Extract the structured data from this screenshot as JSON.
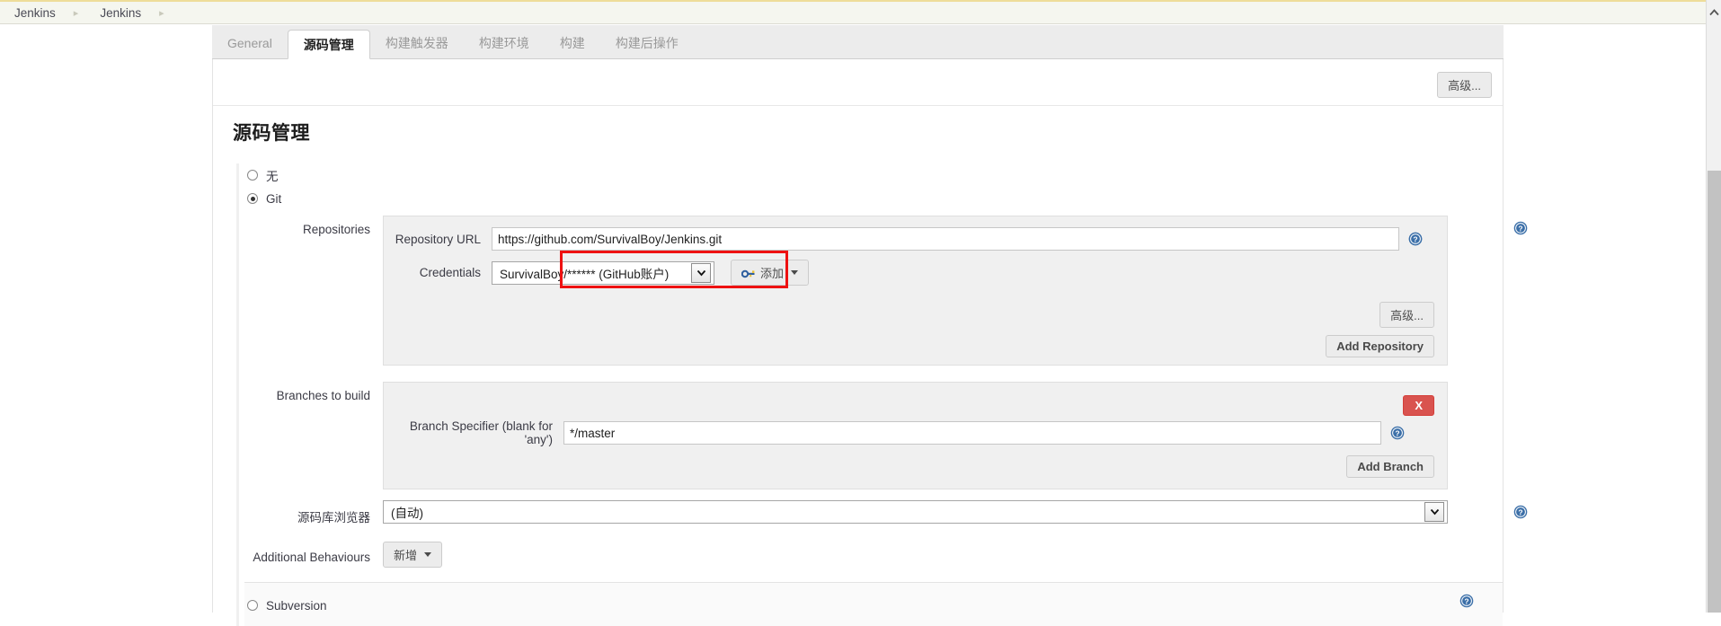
{
  "breadcrumb": {
    "items": [
      {
        "label": "Jenkins"
      },
      {
        "label": "Jenkins"
      }
    ],
    "separator": "▸"
  },
  "tabs": [
    {
      "label": "General",
      "active": false
    },
    {
      "label": "源码管理",
      "active": true
    },
    {
      "label": "构建触发器",
      "active": false
    },
    {
      "label": "构建环境",
      "active": false
    },
    {
      "label": "构建",
      "active": false
    },
    {
      "label": "构建后操作",
      "active": false
    }
  ],
  "toolbar": {
    "advanced_label": "高级..."
  },
  "scm": {
    "title": "源码管理",
    "options": [
      {
        "label": "无",
        "checked": false
      },
      {
        "label": "Git",
        "checked": true
      },
      {
        "label": "Subversion",
        "checked": false
      }
    ],
    "repositories": {
      "label": "Repositories",
      "repository_url": {
        "label": "Repository URL",
        "value": "https://github.com/SurvivalBoy/Jenkins.git"
      },
      "credentials": {
        "label": "Credentials",
        "value": "SurvivalBoy/****** (GitHub账户)",
        "add_label": "添加",
        "highlight_color": "#ee1111"
      },
      "advanced_label": "高级...",
      "add_repository_label": "Add Repository"
    },
    "branches": {
      "label": "Branches to build",
      "specifier": {
        "label": "Branch Specifier (blank for 'any')",
        "value": "*/master"
      },
      "delete_label": "X",
      "add_branch_label": "Add Branch"
    },
    "repo_browser": {
      "label": "源码库浏览器",
      "value": "(自动)"
    },
    "additional_behaviours": {
      "label": "Additional Behaviours",
      "add_label": "新增"
    }
  },
  "icons": {
    "help": "help-icon",
    "key": "key-icon",
    "chevron_down": "chevron-down-icon",
    "scroll_up": "chevron-up-icon"
  },
  "colors": {
    "accent_yellow": "#eedd99",
    "danger_red": "#d9534f",
    "help_blue": "#3b6fa8",
    "highlight_red": "#ee1111"
  }
}
